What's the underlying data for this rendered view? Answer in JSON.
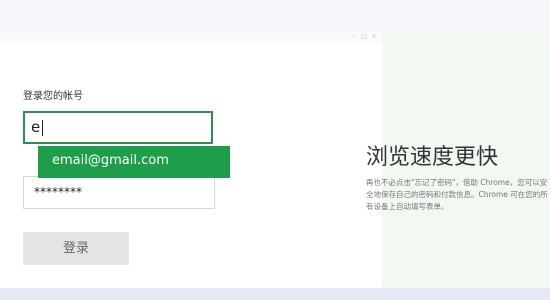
{
  "login": {
    "heading": "登录您的帐号",
    "account_value": "e",
    "autocomplete_suggestion": "email@gmail.com",
    "password_mask": "********",
    "submit_label": "登录"
  },
  "promo": {
    "title": "浏览速度更快",
    "body": "再也不必点击\"忘记了密码\"，借助 Chrome，您可以安全地保存自己的密码和付款信息。Chrome 可在您的所有设备上自动填写表单。"
  },
  "window_controls": {
    "minimize": "–",
    "maximize": "□",
    "close": "×"
  },
  "colors": {
    "focus_border": "#2f8f4e",
    "suggestion_bg": "#1e9e4a",
    "button_bg": "#e5e5e5",
    "right_pane_bg": "#f2f8f2"
  }
}
